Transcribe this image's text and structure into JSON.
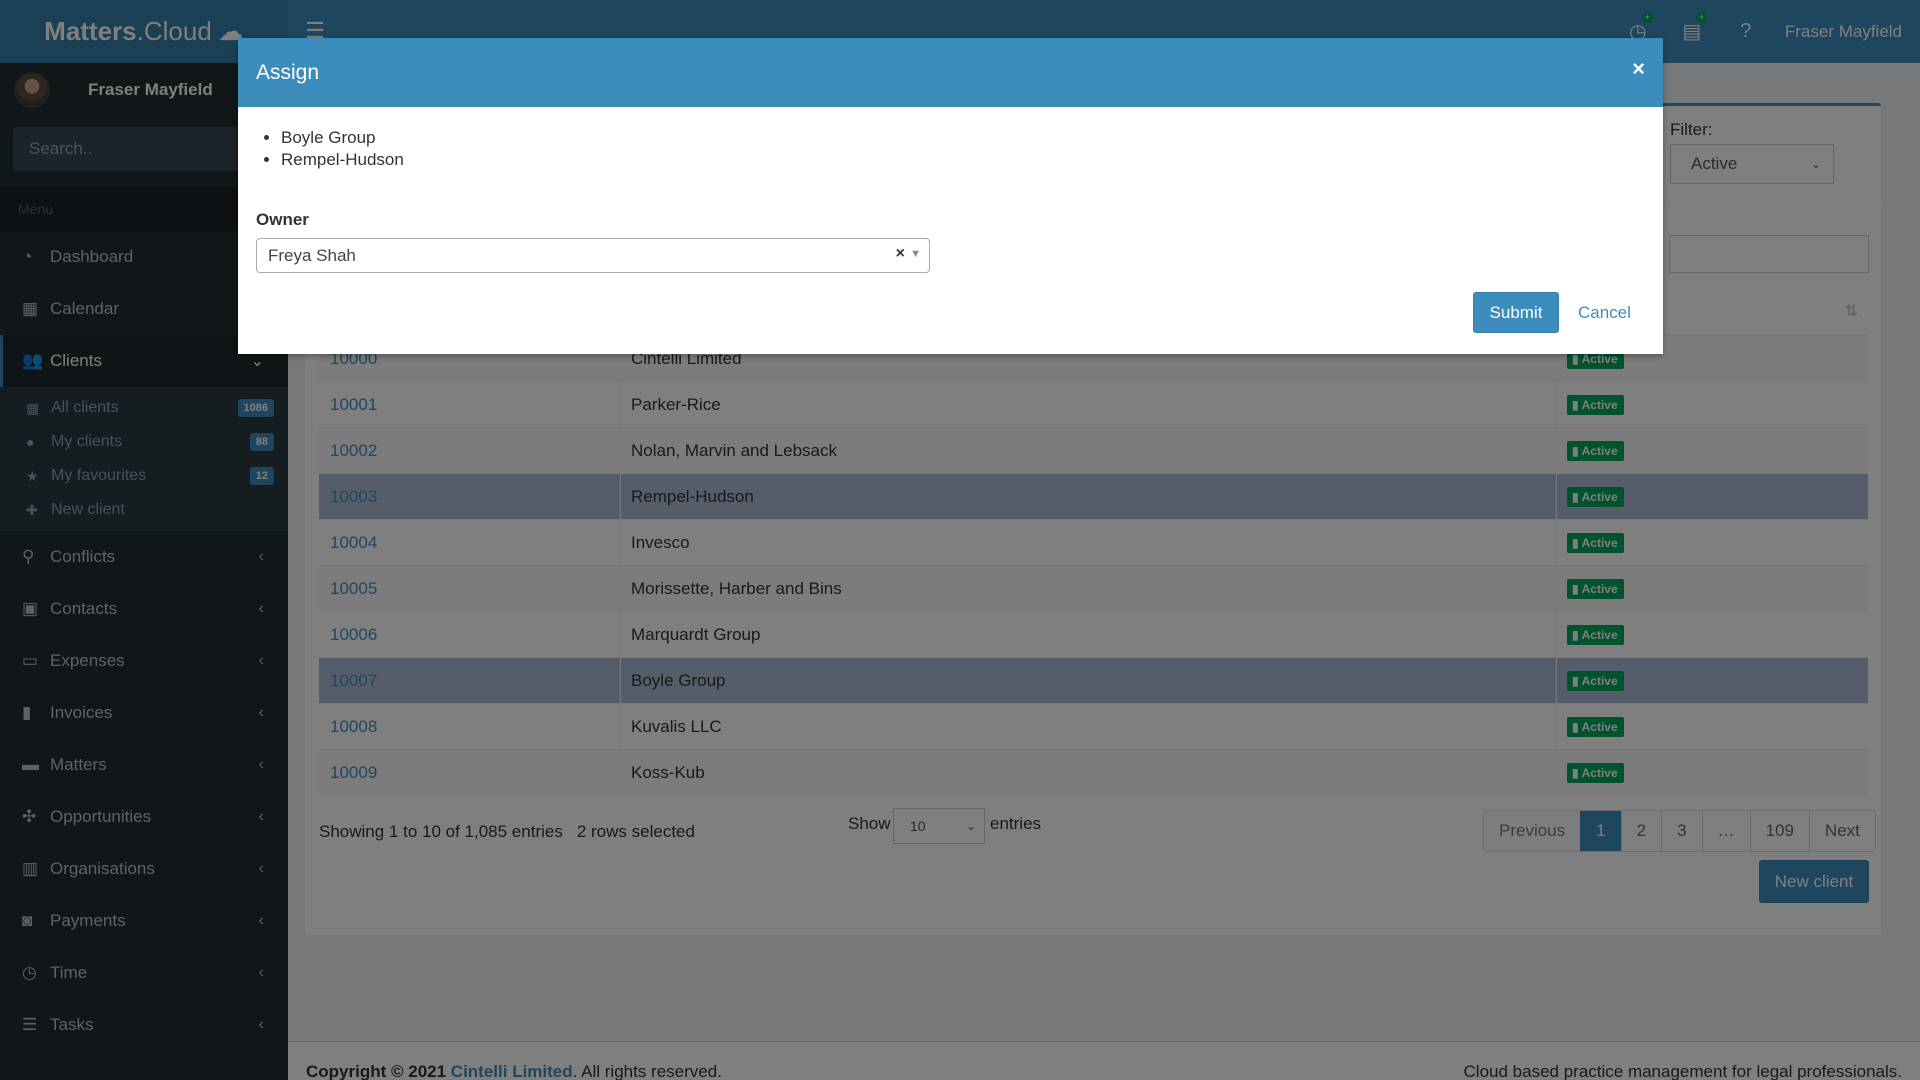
{
  "app": {
    "logo_bold": "Matters",
    "logo_rest": ".Cloud"
  },
  "header": {
    "user_name": "Fraser Mayfield"
  },
  "sidebar": {
    "user_name": "Fraser Mayfield",
    "search_placeholder": "Search..",
    "menu_header": "Menu",
    "items": [
      {
        "label": "Dashboard"
      },
      {
        "label": "Calendar"
      },
      {
        "label": "Clients"
      },
      {
        "label": "Conflicts"
      },
      {
        "label": "Contacts"
      },
      {
        "label": "Expenses"
      },
      {
        "label": "Invoices"
      },
      {
        "label": "Matters"
      },
      {
        "label": "Opportunities"
      },
      {
        "label": "Organisations"
      },
      {
        "label": "Payments"
      },
      {
        "label": "Time"
      },
      {
        "label": "Tasks"
      }
    ],
    "clients_sub": [
      {
        "label": "All clients",
        "badge": "1086"
      },
      {
        "label": "My clients",
        "badge": "88"
      },
      {
        "label": "My favourites",
        "badge": "12"
      },
      {
        "label": "New client"
      }
    ]
  },
  "filter": {
    "label": "Filter:",
    "value": "Active"
  },
  "table": {
    "rows": [
      {
        "id": "10000",
        "name": "Cintelli Limited",
        "status": "Active",
        "selected": false
      },
      {
        "id": "10001",
        "name": "Parker-Rice",
        "status": "Active",
        "selected": false
      },
      {
        "id": "10002",
        "name": "Nolan, Marvin and Lebsack",
        "status": "Active",
        "selected": false
      },
      {
        "id": "10003",
        "name": "Rempel-Hudson",
        "status": "Active",
        "selected": true
      },
      {
        "id": "10004",
        "name": "Invesco",
        "status": "Active",
        "selected": false
      },
      {
        "id": "10005",
        "name": "Morissette, Harber and Bins",
        "status": "Active",
        "selected": false
      },
      {
        "id": "10006",
        "name": "Marquardt Group",
        "status": "Active",
        "selected": false
      },
      {
        "id": "10007",
        "name": "Boyle Group",
        "status": "Active",
        "selected": true
      },
      {
        "id": "10008",
        "name": "Kuvalis LLC",
        "status": "Active",
        "selected": false
      },
      {
        "id": "10009",
        "name": "Koss-Kub",
        "status": "Active",
        "selected": false
      }
    ],
    "info": "Showing 1 to 10 of 1,085 entries",
    "selected_info": "2 rows selected",
    "show_label": "Show",
    "page_size": "10",
    "entries_label": "entries"
  },
  "pagination": {
    "previous": "Previous",
    "pages": [
      "1",
      "2",
      "3",
      "…",
      "109"
    ],
    "next": "Next"
  },
  "new_client_button": "New client",
  "footer": {
    "copyright_prefix": "Copyright © 2021 ",
    "company": "Cintelli Limited",
    "copyright_suffix": ". All rights reserved.",
    "tagline": "Cloud based practice management for legal professionals."
  },
  "modal": {
    "title": "Assign",
    "close": "×",
    "items": [
      "Boyle Group",
      "Rempel-Hudson"
    ],
    "owner_label": "Owner",
    "owner_value": "Freya Shah",
    "submit": "Submit",
    "cancel": "Cancel"
  },
  "colors": {
    "primary": "#3c8dbc",
    "success": "#00a65a",
    "sidebar": "#222d32",
    "selected_row": "#acbad4"
  }
}
